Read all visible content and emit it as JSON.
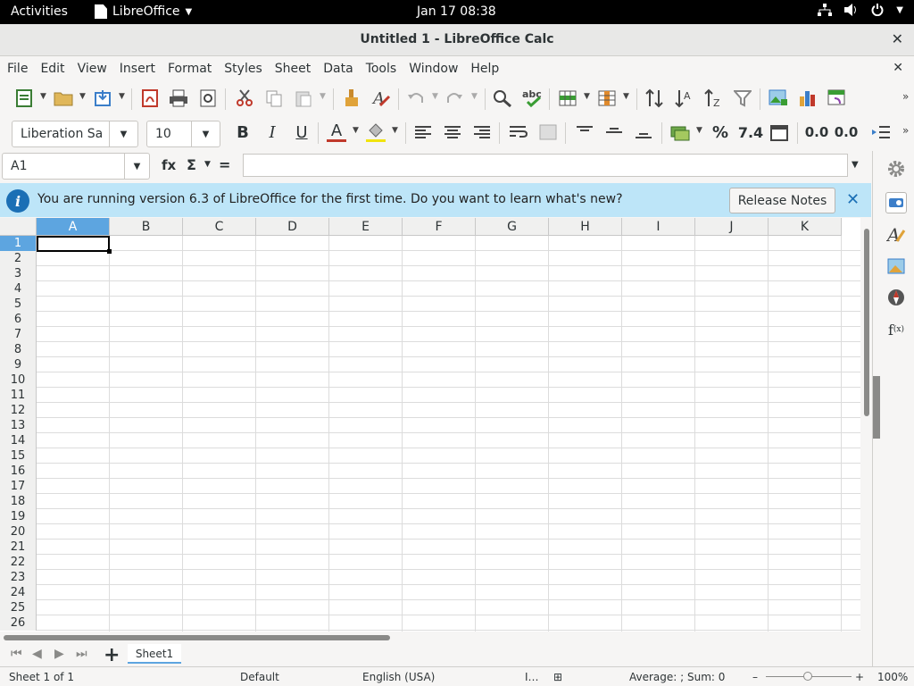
{
  "topbar": {
    "activities": "Activities",
    "app_menu": "LibreOffice",
    "clock": "Jan 17  08:38"
  },
  "window": {
    "title": "Untitled 1 - LibreOffice Calc"
  },
  "menubar": {
    "items": [
      "File",
      "Edit",
      "View",
      "Insert",
      "Format",
      "Styles",
      "Sheet",
      "Data",
      "Tools",
      "Window",
      "Help"
    ]
  },
  "formatting": {
    "font_name": "Liberation Sa",
    "font_size": "10",
    "bold": "B",
    "italic": "I",
    "underline": "U",
    "font_color_glyph": "A",
    "percent": "%",
    "number_format": "7.4",
    "add_decimal": "0.0",
    "remove_decimal": "0.0"
  },
  "formula_bar": {
    "cell_ref": "A1",
    "fx": "fx",
    "sigma": "Σ",
    "equals": "=",
    "content": ""
  },
  "infobar": {
    "message": "You are running version 6.3 of LibreOffice for the first time. Do you want to learn what's new?",
    "release_notes": "Release Notes",
    "close": "✕"
  },
  "grid": {
    "columns": [
      "A",
      "B",
      "C",
      "D",
      "E",
      "F",
      "G",
      "H",
      "I",
      "J",
      "K"
    ],
    "rows": [
      "1",
      "2",
      "3",
      "4",
      "5",
      "6",
      "7",
      "8",
      "9",
      "10",
      "11",
      "12",
      "13",
      "14",
      "15",
      "16",
      "17",
      "18",
      "19",
      "20",
      "21",
      "22",
      "23",
      "24",
      "25",
      "26"
    ],
    "selected_cell": "A1"
  },
  "sheets": {
    "tabs": [
      "Sheet1"
    ]
  },
  "status": {
    "sheet_info": "Sheet 1 of 1",
    "page_style": "Default",
    "language": "English (USA)",
    "summary": "Average: ; Sum: 0",
    "zoom": "100%"
  },
  "colors": {
    "accent": "#5da5e0",
    "infobar": "#bde5f8",
    "info_icon": "#1b6fb5"
  }
}
